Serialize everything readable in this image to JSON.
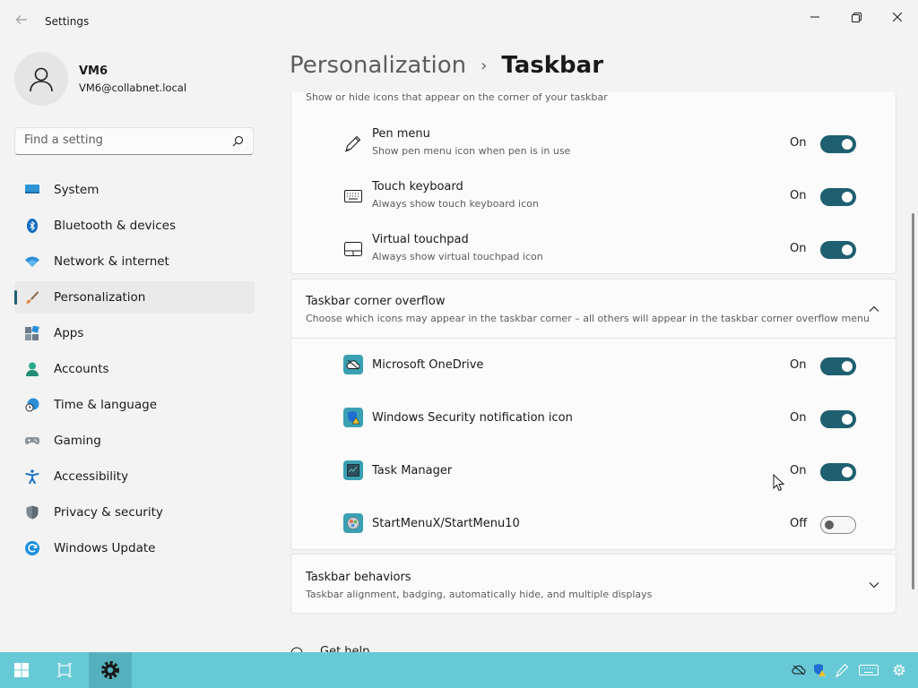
{
  "window": {
    "title": "Settings",
    "back_icon": "back-arrow-icon",
    "controls": [
      "minimize-icon",
      "restore-icon",
      "close-icon"
    ]
  },
  "profile": {
    "name": "VM6",
    "email": "VM6@collabnet.local"
  },
  "search": {
    "placeholder": "Find a setting",
    "value": ""
  },
  "sidebar": {
    "items": [
      {
        "label": "System",
        "icon": "system-icon"
      },
      {
        "label": "Bluetooth & devices",
        "icon": "bluetooth-icon"
      },
      {
        "label": "Network & internet",
        "icon": "wifi-icon"
      },
      {
        "label": "Personalization",
        "icon": "brush-icon",
        "active": true
      },
      {
        "label": "Apps",
        "icon": "apps-icon"
      },
      {
        "label": "Accounts",
        "icon": "account-icon"
      },
      {
        "label": "Time & language",
        "icon": "clock-globe-icon"
      },
      {
        "label": "Gaming",
        "icon": "gamepad-icon"
      },
      {
        "label": "Accessibility",
        "icon": "accessibility-icon"
      },
      {
        "label": "Privacy & security",
        "icon": "shield-icon"
      },
      {
        "label": "Windows Update",
        "icon": "update-icon"
      }
    ]
  },
  "header": {
    "parent": "Personalization",
    "separator": "›",
    "current": "Taskbar"
  },
  "corner_icons": {
    "partial_desc": "Show or hide icons that appear on the corner of your taskbar",
    "items": [
      {
        "title": "Pen menu",
        "desc": "Show pen menu icon when pen is in use",
        "state": "On",
        "icon": "pen-icon"
      },
      {
        "title": "Touch keyboard",
        "desc": "Always show touch keyboard icon",
        "state": "On",
        "icon": "keyboard-icon"
      },
      {
        "title": "Virtual touchpad",
        "desc": "Always show virtual touchpad icon",
        "state": "On",
        "icon": "touchpad-icon"
      }
    ]
  },
  "overflow": {
    "title": "Taskbar corner overflow",
    "desc": "Choose which icons may appear in the taskbar corner – all others will appear in the taskbar corner overflow menu",
    "items": [
      {
        "title": "Microsoft OneDrive",
        "state": "On",
        "icon": "onedrive-icon"
      },
      {
        "title": "Windows Security notification icon",
        "state": "On",
        "icon": "windows-security-icon"
      },
      {
        "title": "Task Manager",
        "state": "On",
        "icon": "task-manager-icon"
      },
      {
        "title": "StartMenuX/StartMenu10",
        "state": "Off",
        "icon": "startmenux-icon"
      }
    ]
  },
  "behaviors": {
    "title": "Taskbar behaviors",
    "desc": "Taskbar alignment, badging, automatically hide, and multiple displays"
  },
  "footer": {
    "get_help": "Get help"
  },
  "colors": {
    "accent": "#1e5f70",
    "taskbar": "#68c9d6"
  }
}
